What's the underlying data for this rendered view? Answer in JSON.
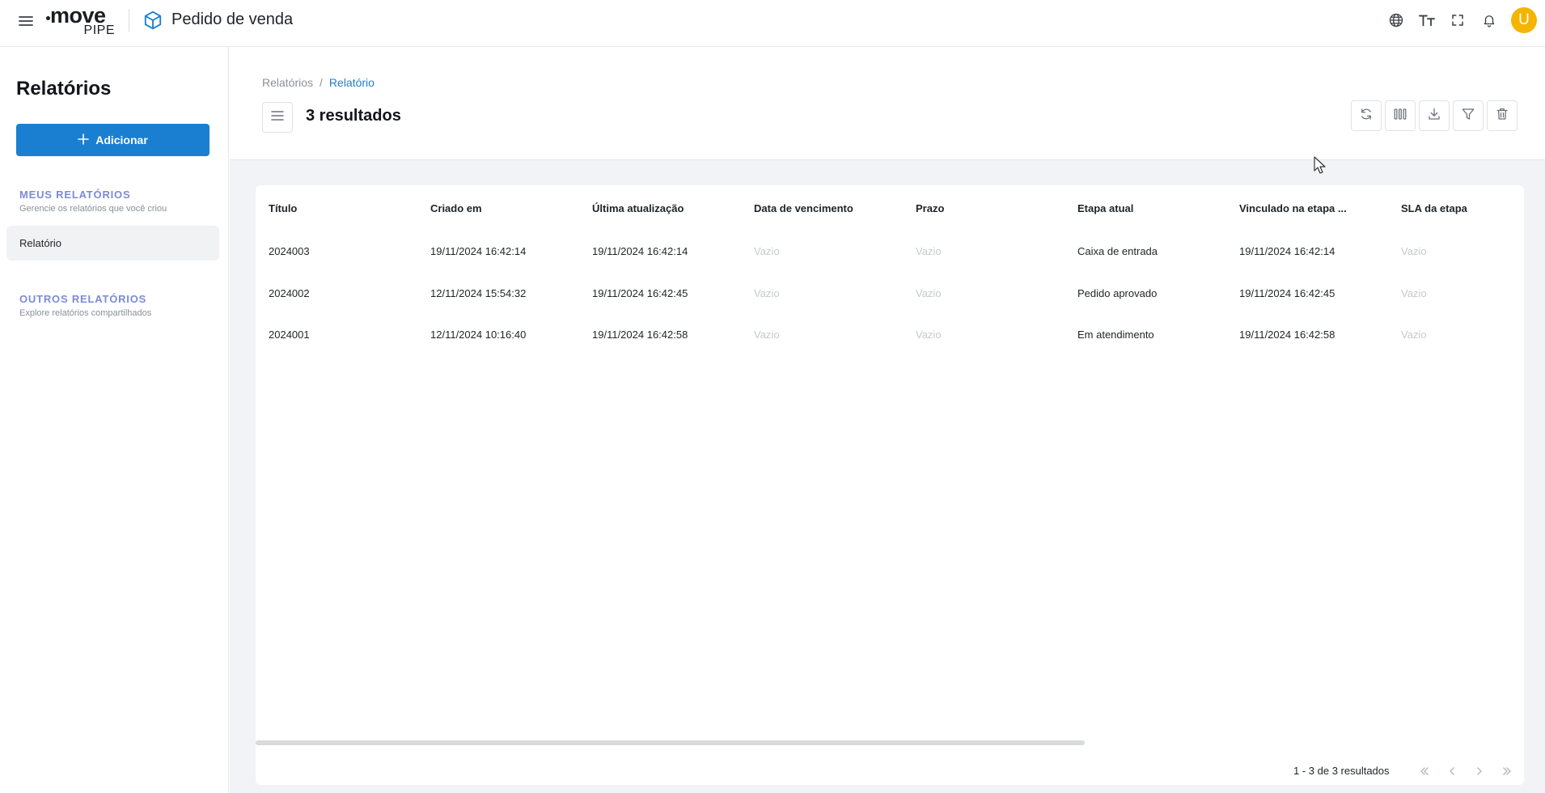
{
  "header": {
    "logo_text": "move",
    "logo_sub": "PIPE",
    "app_title": "Pedido de venda",
    "avatar_letter": "U",
    "icons": [
      "menu-icon",
      "box-icon",
      "globe-icon",
      "text-size-icon",
      "fullscreen-icon",
      "bell-icon"
    ]
  },
  "sidebar": {
    "title": "Relatórios",
    "add_label": "Adicionar",
    "my_reports": {
      "title": "MEUS RELATÓRIOS",
      "subtitle": "Gerencie os relatórios que você criou"
    },
    "items": [
      {
        "label": "Relatório"
      }
    ],
    "other_reports": {
      "title": "OUTROS RELATÓRIOS",
      "subtitle": "Explore relatórios compartilhados"
    }
  },
  "main": {
    "breadcrumb": {
      "root": "Relatórios",
      "separator": "/",
      "current": "Relatório"
    },
    "results_title": "3 resultados",
    "toolbar": [
      "refresh-icon",
      "columns-icon",
      "download-icon",
      "filter-icon",
      "trash-icon"
    ]
  },
  "table": {
    "columns": [
      "Título",
      "Criado em",
      "Última atualização",
      "Data de vencimento",
      "Prazo",
      "Etapa atual",
      "Vinculado na etapa ...",
      "SLA da etapa"
    ],
    "rows": [
      [
        "2024003",
        "19/11/2024 16:42:14",
        "19/11/2024 16:42:14",
        "Vazio",
        "Vazio",
        "Caixa de entrada",
        "19/11/2024 16:42:14",
        "Vazio"
      ],
      [
        "2024002",
        "12/11/2024 15:54:32",
        "19/11/2024 16:42:45",
        "Vazio",
        "Vazio",
        "Pedido aprovado",
        "19/11/2024 16:42:45",
        "Vazio"
      ],
      [
        "2024001",
        "12/11/2024 10:16:40",
        "19/11/2024 16:42:58",
        "Vazio",
        "Vazio",
        "Em atendimento",
        "19/11/2024 16:42:58",
        "Vazio"
      ]
    ],
    "empty_value": "Vazio",
    "pagination_text": "1 - 3 de 3 resultados"
  },
  "colors": {
    "primary": "#1a7fd1",
    "section_title": "#7c8bd6",
    "avatar": "#f5b400",
    "content_bg": "#f1f3f6",
    "empty_text": "#c5c9cf"
  }
}
